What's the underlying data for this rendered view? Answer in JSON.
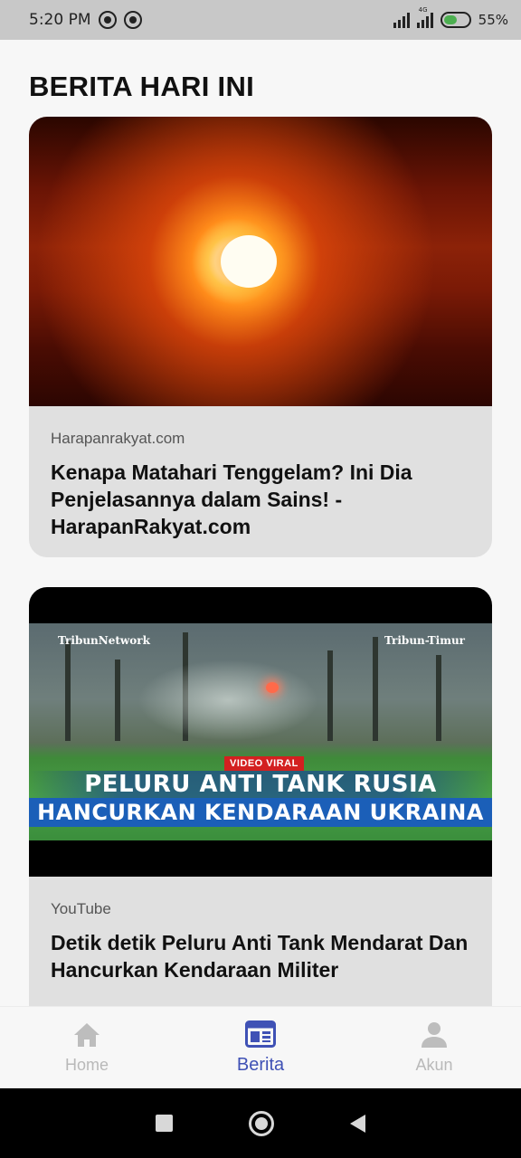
{
  "status_bar": {
    "time": "5:20 PM",
    "network_label": "4G",
    "battery": "55%",
    "battery_level": 0.55
  },
  "page": {
    "title": "BERITA HARI INI"
  },
  "articles": [
    {
      "source": "Harapanrakyat.com",
      "title": "Kenapa Matahari Tenggelam? Ini Dia Penjelasannya dalam Sains! - HarapanRakyat.com",
      "image": "sunset-photo"
    },
    {
      "source": "YouTube",
      "title": "Detik detik Peluru Anti Tank Mendarat Dan Hancurkan Kendaraan Militer",
      "image": "video-thumbnail",
      "thumbnail": {
        "watermark_left": "TribunNetwork",
        "watermark_right": "Tribun-Timur",
        "tag": "VIDEO VIRAL",
        "headline_line_1": "PELURU ANTI TANK RUSIA",
        "headline_line_2": "HANCURKAN KENDARAAN UKRAINA"
      }
    }
  ],
  "bottom_nav": {
    "items": [
      {
        "label": "Home",
        "icon": "home-icon",
        "active": false
      },
      {
        "label": "Berita",
        "icon": "newspaper-icon",
        "active": true
      },
      {
        "label": "Akun",
        "icon": "person-icon",
        "active": false
      }
    ],
    "active_color": "#3f51b5",
    "inactive_color": "#b9b9b9"
  }
}
